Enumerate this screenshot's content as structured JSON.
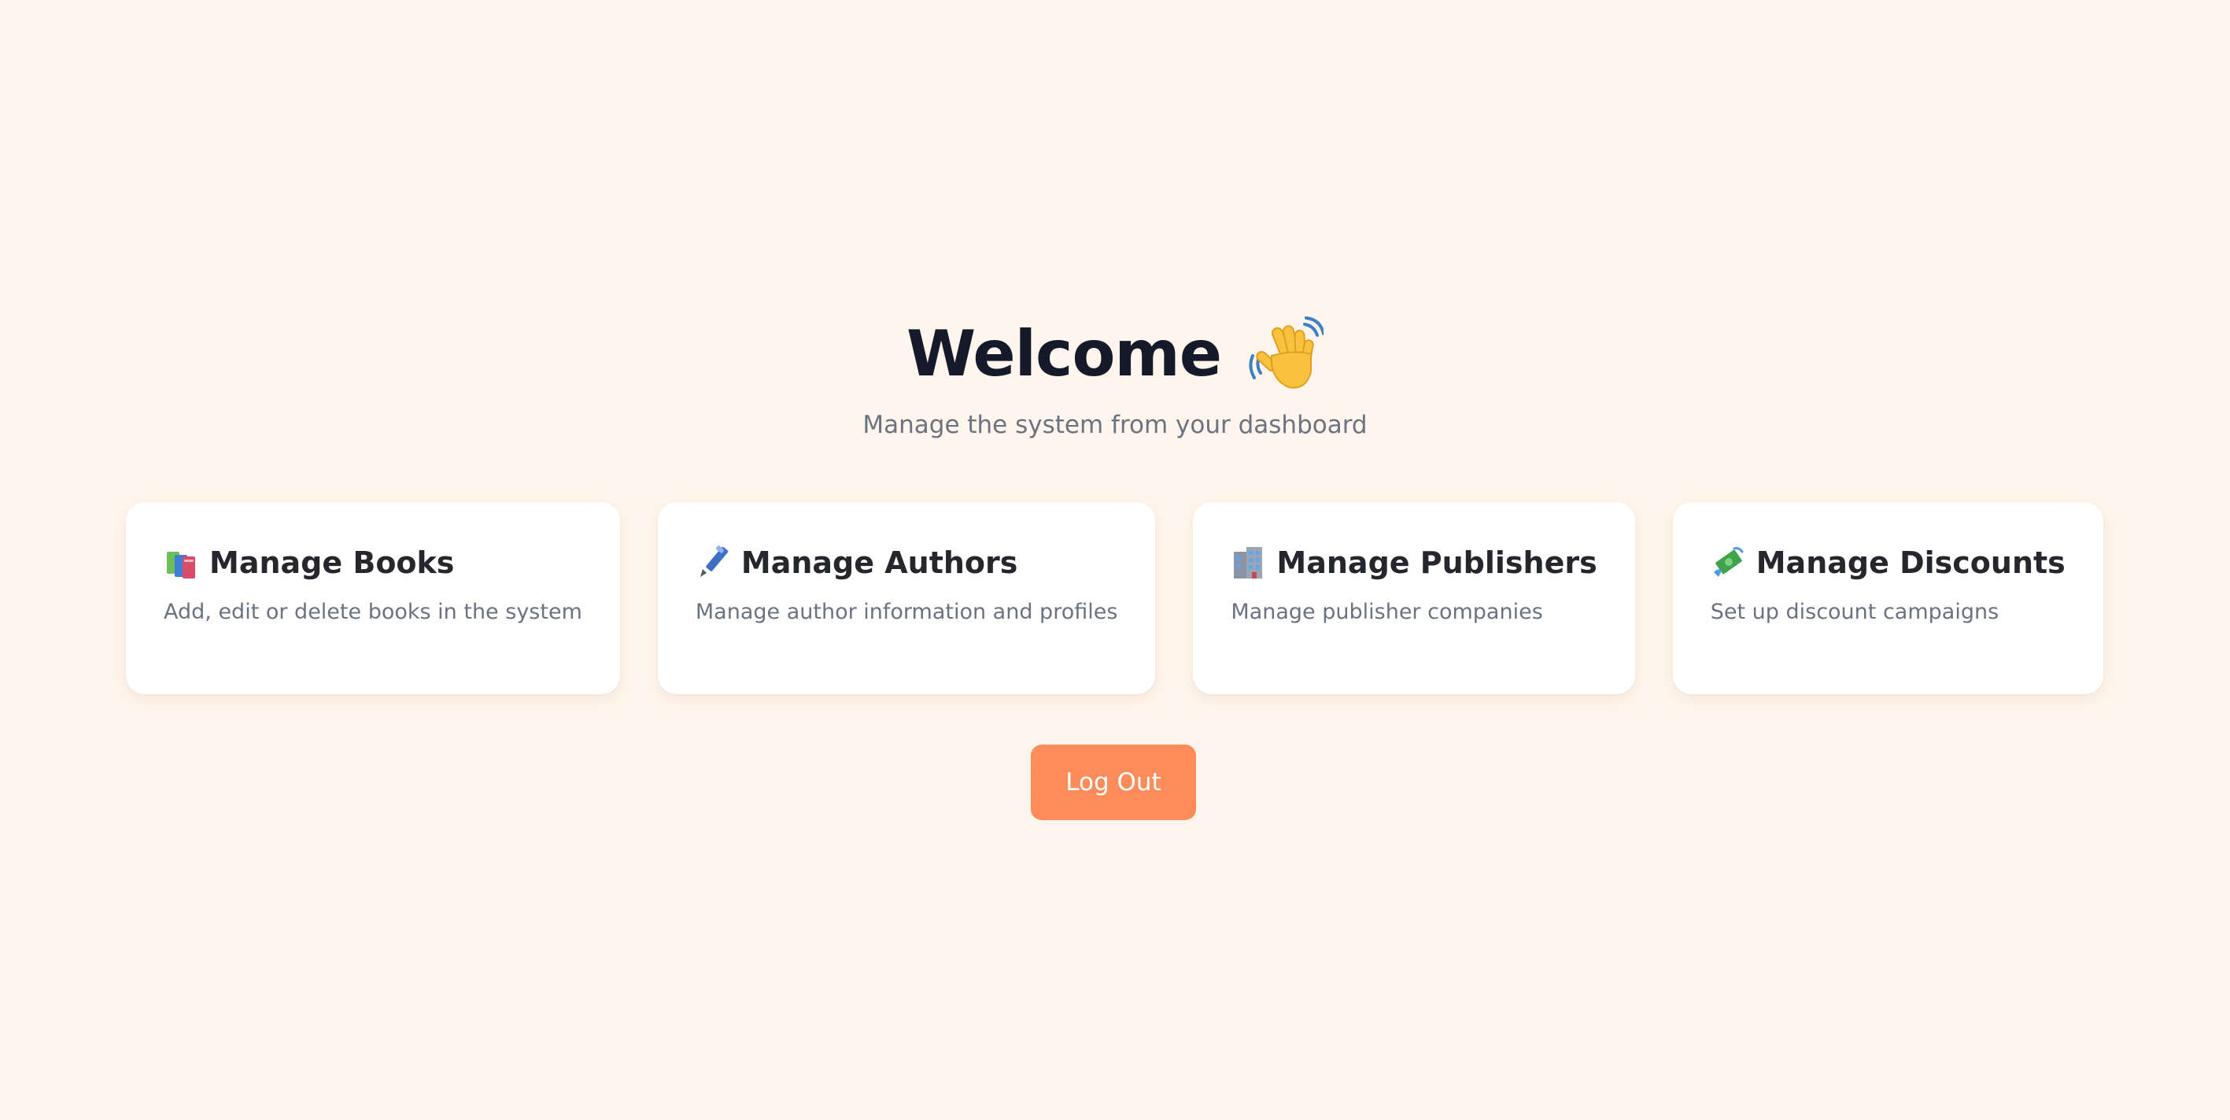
{
  "header": {
    "title": "Welcome",
    "title_icon": "waving-hand-icon",
    "subtitle": "Manage the system from your dashboard"
  },
  "cards": [
    {
      "title": "Manage Books",
      "description": "Add, edit or delete books in the system",
      "icon": "books-icon"
    },
    {
      "title": "Manage Authors",
      "description": "Manage author information and profiles",
      "icon": "pen-icon"
    },
    {
      "title": "Manage Publishers",
      "description": "Manage publisher companies",
      "icon": "building-icon"
    },
    {
      "title": "Manage Discounts",
      "description": "Set up discount campaigns",
      "icon": "money-icon"
    }
  ],
  "logout": {
    "label": "Log Out"
  },
  "colors": {
    "background": "#fff5ec",
    "card": "#ffffff",
    "accent": "#fd8c5a",
    "title": "#141a2a",
    "muted": "#6b7280"
  }
}
